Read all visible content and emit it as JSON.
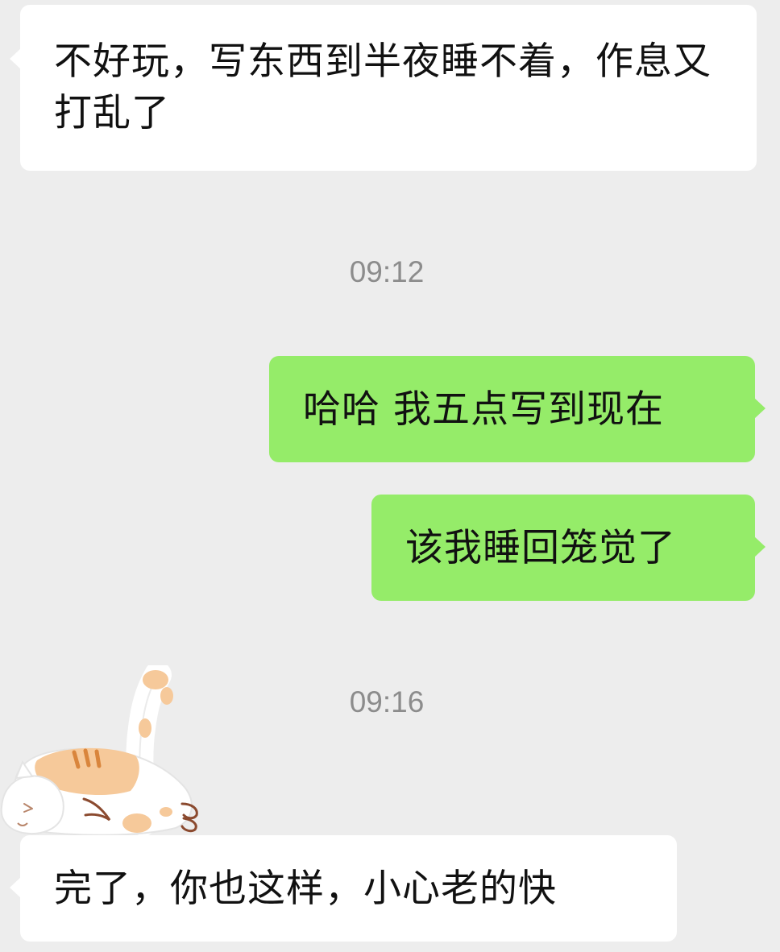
{
  "chat": {
    "messages": [
      {
        "side": "incoming",
        "text": "不好玩，写东西到半夜睡不着，作息又打乱了"
      },
      {
        "side": "outgoing",
        "text": "哈哈 我五点写到现在"
      },
      {
        "side": "outgoing",
        "text": "该我睡回笼觉了"
      },
      {
        "side": "incoming",
        "text": "完了，你也这样，小心老的快"
      }
    ],
    "timestamps": [
      "09:12",
      "09:16"
    ],
    "sticker": {
      "icon": "sleeping-cat-sticker"
    }
  },
  "colors": {
    "background": "#ededed",
    "incoming_bubble": "#ffffff",
    "outgoing_bubble": "#95ec69",
    "timestamp_text": "#8c8c8c"
  }
}
